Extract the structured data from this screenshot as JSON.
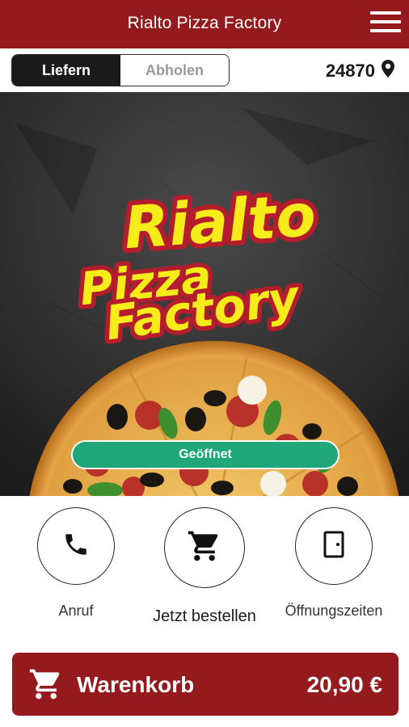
{
  "app": {
    "title": "Rialto Pizza Factory",
    "accent_color": "#941a1d"
  },
  "mode_toggle": {
    "active": "Liefern",
    "inactive": "Abholen"
  },
  "location": {
    "zip": "24870",
    "icon": "map-pin-icon"
  },
  "hero": {
    "logo_line1": "Rialto",
    "logo_line2": "Pizza",
    "logo_line3": "Factory",
    "status_label": "Geöffnet",
    "status_color": "#1fa77a"
  },
  "actions": [
    {
      "label": "Anruf",
      "icon": "phone-icon"
    },
    {
      "label": "Jetzt bestellen",
      "icon": "cart-icon"
    },
    {
      "label": "Öffnungszeiten",
      "icon": "door-icon"
    }
  ],
  "cart": {
    "label": "Warenkorb",
    "total": "20,90 €",
    "icon": "cart-icon"
  }
}
